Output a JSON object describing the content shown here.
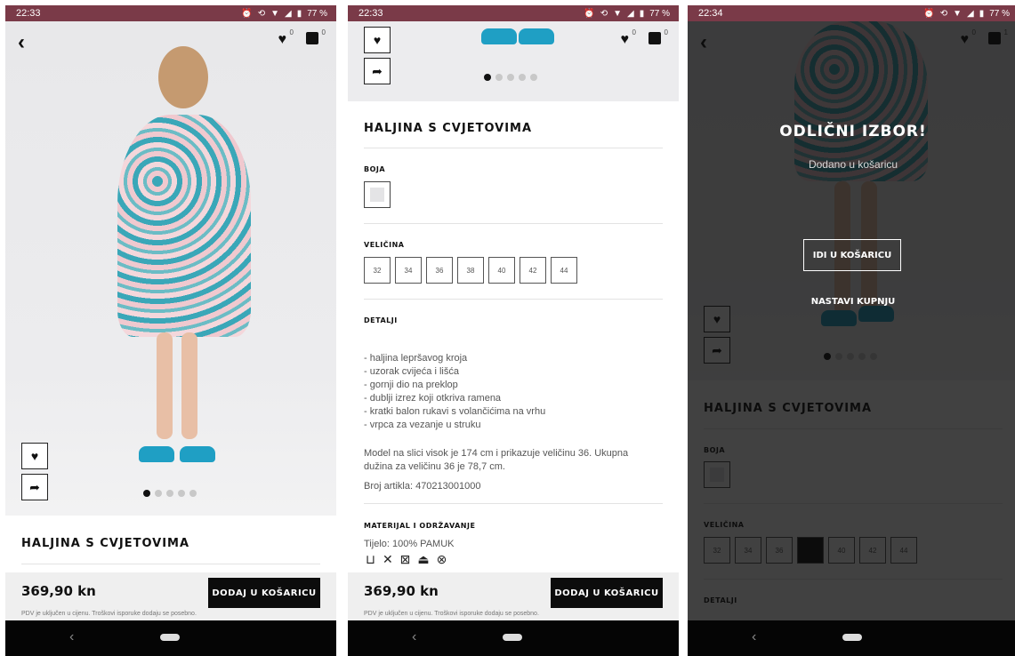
{
  "colors": {
    "status_bar": "#7a3a48",
    "primary_button": "#0c0c0c",
    "shoe_blue": "#1f9fc4",
    "dress_teal": "#3aa7b8"
  },
  "panels": [
    {
      "time": "22:33",
      "battery": "77 %",
      "wishlist_count": "0",
      "cart_count": "0"
    },
    {
      "time": "22:33",
      "battery": "77 %",
      "wishlist_count": "0",
      "cart_count": "0"
    },
    {
      "time": "22:34",
      "battery": "77 %",
      "wishlist_count": "0",
      "cart_count": "1"
    }
  ],
  "product": {
    "title": "HALJINA S CVJETOVIMA",
    "price": "369,90 kn",
    "add_to_cart": "DODAJ U KOŠARICU",
    "shipping_note": "PDV je uključen u cijenu. Troškovi isporuke dodaju se posebno.",
    "color_label": "BOJA",
    "size_label": "VELIČINA",
    "sizes": [
      "32",
      "34",
      "36",
      "38",
      "40",
      "42",
      "44"
    ],
    "details_label": "DETALJI",
    "details_text": "- haljina lepršavog kroja\n- uzorak cvijeća i lišća\n- gornji dio na preklop\n- dublji izrez koji otkriva ramena\n- kratki balon rukavi s volančićima na vrhu\n- vrpca za vezanje u struku",
    "model_text": "Model na slici visok je 174 cm i prikazuje veličinu 36. Ukupna dužina za veličinu 36 je 78,7 cm.",
    "article": "Broj artikla: 470213001000",
    "material_label": "MATERIJAL I ODRŽAVANJE",
    "material_text": "Tijelo: 100% PAMUK",
    "care_icons": [
      "wash-30-icon",
      "no-bleach-icon",
      "no-tumble-dry-icon",
      "iron-icon",
      "no-dry-clean-icon"
    ]
  },
  "overlay": {
    "title": "ODLIČNI IZBOR!",
    "subtitle": "Dodano u košaricu",
    "go_to_cart": "IDI U KOŠARICU",
    "continue": "NASTAVI KUPNJU"
  }
}
